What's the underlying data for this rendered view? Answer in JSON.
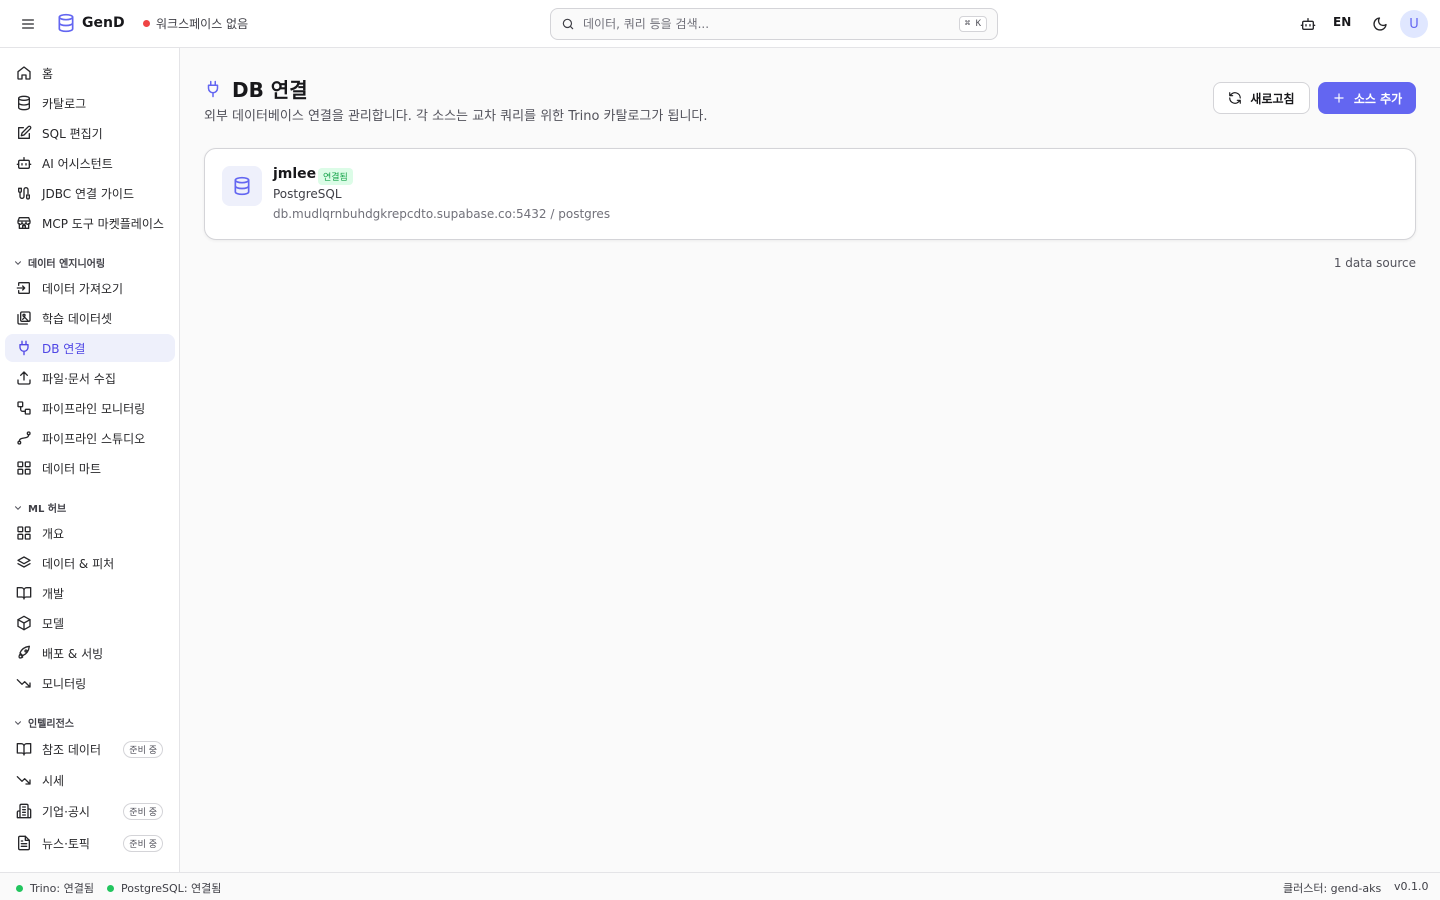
{
  "header": {
    "logo": "GenD",
    "workspace": "워크스페이스 없음",
    "search_placeholder": "데이터, 쿼리 등을 검색...",
    "search_shortcut": "⌘ K",
    "lang": "EN",
    "avatar": "U"
  },
  "sidebar": {
    "items_top": [
      {
        "label": "홈",
        "icon": "home-icon"
      },
      {
        "label": "카탈로그",
        "icon": "database-icon"
      },
      {
        "label": "SQL 편집기",
        "icon": "edit-icon"
      },
      {
        "label": "AI 어시스턴트",
        "icon": "bot-icon"
      },
      {
        "label": "JDBC 연결 가이드",
        "icon": "cable-icon"
      },
      {
        "label": "MCP 도구 마켓플레이스",
        "icon": "store-icon"
      }
    ],
    "sections": [
      {
        "title": "데이터 엔지니어링",
        "items": [
          {
            "label": "데이터 가져오기",
            "icon": "import-icon"
          },
          {
            "label": "학습 데이터셋",
            "icon": "images-icon"
          },
          {
            "label": "DB 연결",
            "icon": "plug-icon",
            "active": true
          },
          {
            "label": "파일·문서 수집",
            "icon": "upload-icon"
          },
          {
            "label": "파이프라인 모니터링",
            "icon": "workflow-icon"
          },
          {
            "label": "파이프라인 스튜디오",
            "icon": "spline-icon"
          },
          {
            "label": "데이터 마트",
            "icon": "grid-icon"
          }
        ]
      },
      {
        "title": "ML 허브",
        "items": [
          {
            "label": "개요",
            "icon": "grid-icon"
          },
          {
            "label": "데이터 & 피처",
            "icon": "layers-icon"
          },
          {
            "label": "개발",
            "icon": "book-open-icon"
          },
          {
            "label": "모델",
            "icon": "box-icon"
          },
          {
            "label": "배포 & 서빙",
            "icon": "rocket-icon"
          },
          {
            "label": "모니터링",
            "icon": "trending-down-icon"
          }
        ]
      },
      {
        "title": "인텔리전스",
        "items": [
          {
            "label": "참조 데이터",
            "icon": "book-open-icon",
            "badge": "준비 중"
          },
          {
            "label": "시세",
            "icon": "trending-down-icon"
          },
          {
            "label": "기업·공시",
            "icon": "building-icon",
            "badge": "준비 중"
          },
          {
            "label": "뉴스·토픽",
            "icon": "file-text-icon",
            "badge": "준비 중"
          }
        ]
      }
    ]
  },
  "main": {
    "title": "DB 연결",
    "subtitle": "외부 데이터베이스 연결을 관리합니다. 각 소스는 교차 쿼리를 위한 Trino 카탈로그가 됩니다.",
    "refresh_label": "새로고침",
    "add_label": "소스 추가",
    "source": {
      "name": "jmlee",
      "status": "연결됨",
      "type": "PostgreSQL",
      "host": "db.mudlqrnbuhdgkrepcdto.supabase.co:5432 / postgres"
    },
    "count": "1 data source"
  },
  "statusbar": {
    "trino": "Trino: 연결됨",
    "postgres": "PostgreSQL: 연결됨",
    "cluster": "클러스터: gend-aks",
    "version": "v0.1.0"
  },
  "colors": {
    "accent": "#6366f1",
    "active_bg": "#eef0fb",
    "success": "#22c55e",
    "error": "#ef4444"
  }
}
